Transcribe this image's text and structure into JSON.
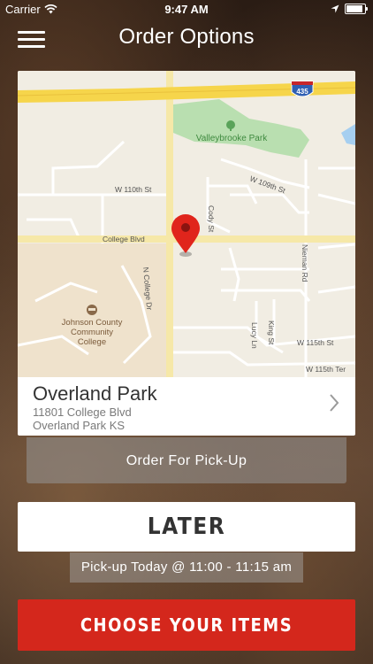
{
  "status_bar": {
    "carrier": "Carrier",
    "time": "9:47 AM"
  },
  "nav": {
    "title": "Order Options"
  },
  "map": {
    "labels": {
      "park": "Valleybrooke Park",
      "interstate": "435",
      "w110": "W 110th St",
      "w109": "W 109th St",
      "cody": "Cody St",
      "college_blvd": "College Blvd",
      "n_college": "N College Dr",
      "nieman": "Nieman Rd",
      "king": "King St",
      "lucy": "Lucy Ln",
      "w115": "W 115th St",
      "w115ter": "W 115th Ter",
      "college_name_1": "Johnson County",
      "college_name_2": "Community",
      "college_name_3": "College"
    }
  },
  "location": {
    "name": "Overland Park",
    "address_line1": "11801 College Blvd",
    "address_line2": "Overland Park KS"
  },
  "order_type": "Order For Pick-Up",
  "timing": "LATER",
  "pickup_time": "Pick-up Today @ 11:00 - 11:15 am",
  "cta": "CHOOSE YOUR ITEMS",
  "colors": {
    "accent": "#d4271c",
    "pin": "#e0251c"
  }
}
